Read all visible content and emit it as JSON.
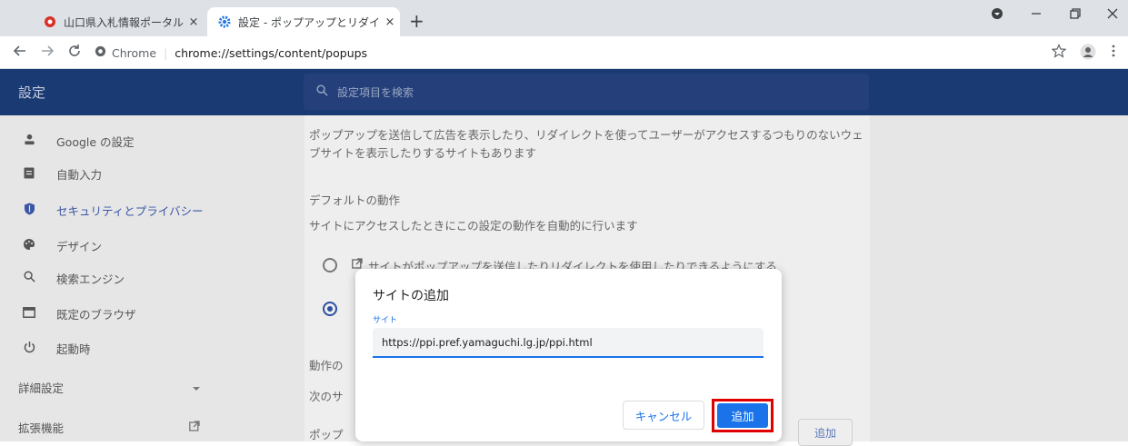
{
  "browser": {
    "tabs": [
      {
        "title": "山口県入札情報ポータルサイト・トッ",
        "close": "×"
      },
      {
        "title": "設定 - ポップアップとリダイレクト",
        "close": "×"
      }
    ],
    "new_tab": "+",
    "omnibox": {
      "chip": "Chrome",
      "url": "chrome://settings/content/popups"
    }
  },
  "header": {
    "title": "設定",
    "search_placeholder": "設定項目を検索"
  },
  "sidebar": {
    "items": [
      {
        "label": "Google の設定"
      },
      {
        "label": "自動入力"
      },
      {
        "label": "セキュリティとプライバシー"
      },
      {
        "label": "デザイン"
      },
      {
        "label": "検索エンジン"
      },
      {
        "label": "既定のブラウザ"
      },
      {
        "label": "起動時"
      },
      {
        "label": "詳細設定"
      },
      {
        "label": "拡張機能"
      }
    ]
  },
  "content": {
    "description_line1": "ポップアップを送信して広告を表示したり、リダイレクトを使ってユーザーがアクセスするつもりのないウェ",
    "description_line2": "ブサイトを表示したりするサイトもあります",
    "default_heading": "デフォルトの動作",
    "default_sub": "サイトにアクセスしたときにこの設定の動作を自動的に行います",
    "option_allow": "サイトがポップアップを送信したりリダイレクトを使用したりできるようにする",
    "behavior_label": "動作の",
    "next_label": "次のサ",
    "popup_label": "ポップ",
    "add_button": "追加"
  },
  "dialog": {
    "title": "サイトの追加",
    "field_label": "サイト",
    "field_value": "https://ppi.pref.yamaguchi.lg.jp/ppi.html",
    "cancel": "キャンセル",
    "add": "追加"
  },
  "colors": {
    "header_bg": "#1a3a73",
    "accent": "#1a73e8",
    "highlight": "#e00000"
  }
}
